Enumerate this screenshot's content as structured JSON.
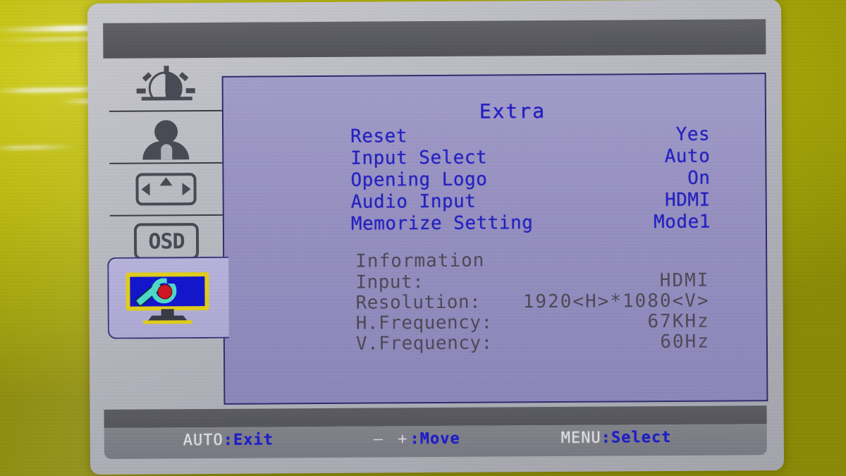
{
  "osd": {
    "title": "Extra",
    "menu_items": [
      {
        "label": "Reset",
        "value": "Yes"
      },
      {
        "label": "Input Select",
        "value": "Auto"
      },
      {
        "label": "Opening Logo",
        "value": "On"
      },
      {
        "label": "Audio Input",
        "value": "HDMI"
      },
      {
        "label": "Memorize Setting",
        "value": "Mode1"
      }
    ],
    "information": {
      "heading": "Information",
      "rows": [
        {
          "label": "Input:",
          "value": "HDMI"
        },
        {
          "label": "Resolution:",
          "value": "1920<H>*1080<V>"
        },
        {
          "label": "H.Frequency:",
          "value": "67KHz"
        },
        {
          "label": "V.Frequency:",
          "value": "60Hz"
        }
      ]
    },
    "sidebar": {
      "icons": [
        {
          "name": "brightness-contrast-icon"
        },
        {
          "name": "color-icon"
        },
        {
          "name": "position-icon"
        },
        {
          "name": "osd-icon",
          "label": "OSD"
        }
      ],
      "active_tab": {
        "name": "extra-icon",
        "label": "Extra"
      }
    },
    "status_bar": [
      {
        "key": "AUTO",
        "value": ":Exit",
        "symbol": ""
      },
      {
        "key": "",
        "value": ":Move",
        "symbol": "—  +"
      },
      {
        "key": "MENU",
        "value": ":Select",
        "symbol": ""
      }
    ],
    "colors": {
      "menu_text": "#1d1ac9",
      "info_text": "#4a4754",
      "panel_bg": "#9a93c8",
      "frame_gray": "#c2c2ca",
      "background_yellow": "#b9b806",
      "accent_yellow": "#e8d41a",
      "accent_blue": "#1014d2",
      "accent_cyan": "#4fe0cf",
      "accent_red": "#d4141e"
    }
  }
}
